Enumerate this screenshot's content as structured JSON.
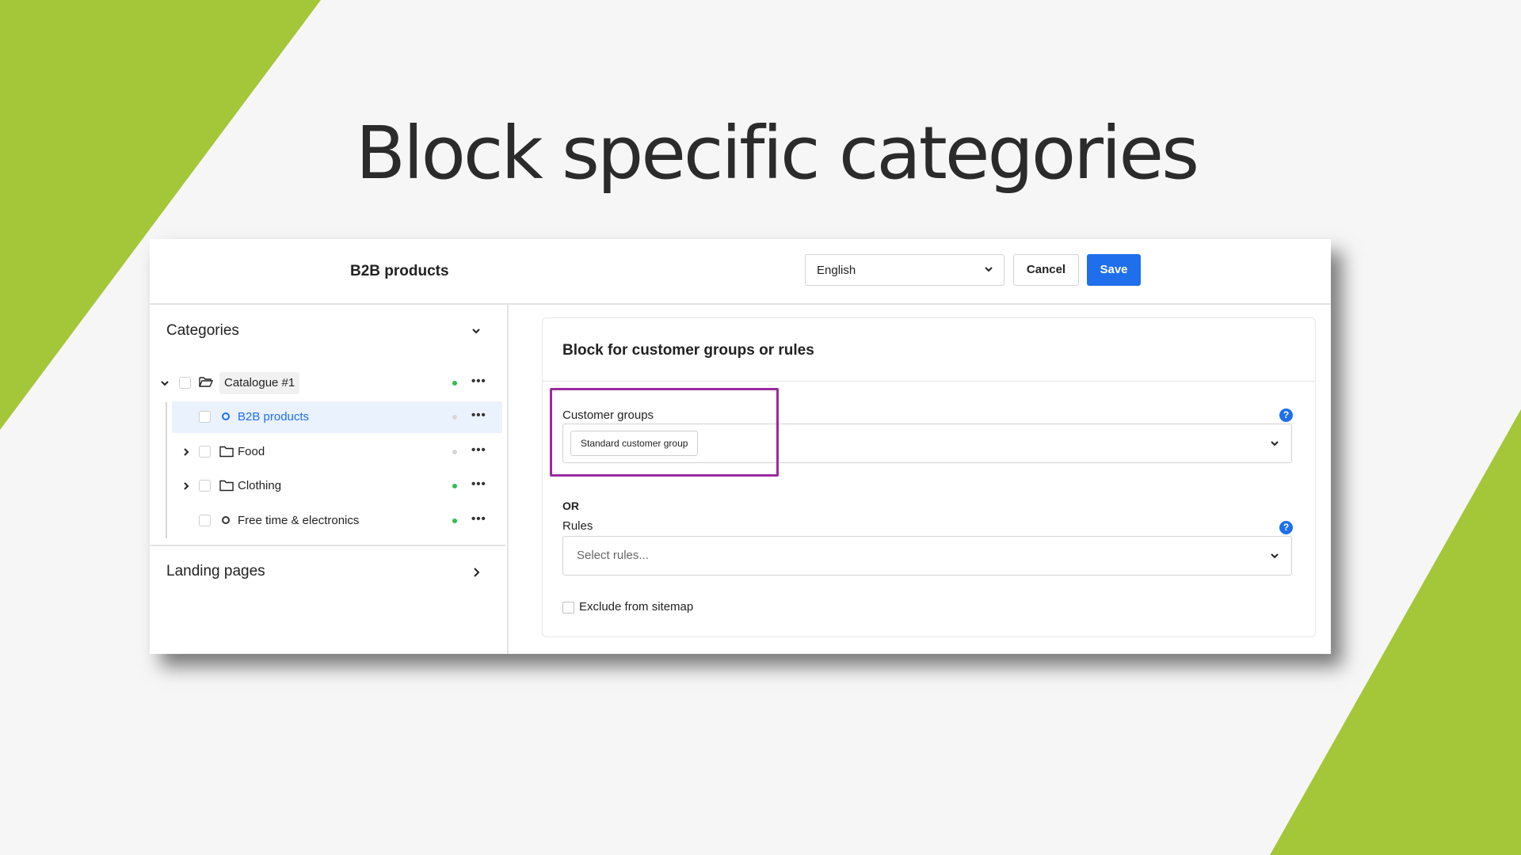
{
  "slide": {
    "title": "Block specific categories",
    "accent_color": "#a4c639",
    "highlight_color": "#9b2a9e"
  },
  "header": {
    "page_title": "B2B products",
    "language": {
      "selected": "English"
    },
    "cancel_label": "Cancel",
    "save_label": "Save",
    "save_color": "#1f6fec"
  },
  "sidebar": {
    "categories_title": "Categories",
    "tree": [
      {
        "label": "Catalogue #1",
        "icon": "folder-open-icon",
        "status": "active",
        "expanded": true
      },
      {
        "label": "B2B products",
        "icon": "bullet-icon",
        "status": "inactive",
        "selected": true
      },
      {
        "label": "Food",
        "icon": "folder-icon",
        "status": "inactive",
        "expandable": true
      },
      {
        "label": "Clothing",
        "icon": "folder-icon",
        "status": "active",
        "expandable": true
      },
      {
        "label": "Free time & electronics",
        "icon": "bullet-icon",
        "status": "active"
      }
    ],
    "landing_pages_title": "Landing pages"
  },
  "main": {
    "card_title": "Block for customer groups or rules",
    "customer_groups": {
      "label": "Customer groups",
      "selected_tags": [
        "Standard customer group"
      ]
    },
    "or_label": "OR",
    "rules": {
      "label": "Rules",
      "placeholder": "Select rules..."
    },
    "exclude_sitemap_label": "Exclude from sitemap"
  }
}
